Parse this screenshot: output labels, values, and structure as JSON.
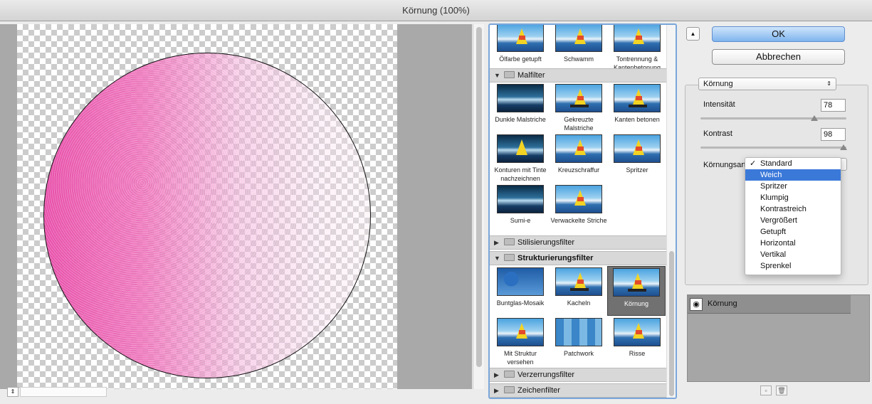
{
  "window": {
    "title": "Körnung (100%)"
  },
  "preview": {
    "zoom_glyph": "⇕"
  },
  "gallery": {
    "top_tiles": [
      {
        "label": "Ölfarbe getupft"
      },
      {
        "label": "Schwamm"
      },
      {
        "label": "Tontrennung & Kantenbetonung"
      }
    ],
    "groups": [
      {
        "name": "Malfilter",
        "expanded": true
      },
      {
        "name": "Stilisierungsfilter",
        "expanded": false
      },
      {
        "name": "Strukturierungsfilter",
        "expanded": true
      },
      {
        "name": "Verzerrungsfilter",
        "expanded": false
      },
      {
        "name": "Zeichenfilter",
        "expanded": false
      }
    ],
    "malfilter": [
      {
        "label": "Dunkle Malstriche"
      },
      {
        "label": "Gekreuzte Malstriche"
      },
      {
        "label": "Kanten betonen"
      },
      {
        "label": "Konturen mit Tinte nachzeichnen"
      },
      {
        "label": "Kreuzschraffur"
      },
      {
        "label": "Spritzer"
      },
      {
        "label": "Sumi-e"
      },
      {
        "label": "Verwackelte Striche"
      }
    ],
    "strukturierungsfilter": [
      {
        "label": "Buntglas-Mosaik"
      },
      {
        "label": "Kacheln"
      },
      {
        "label": "Körnung",
        "selected": true
      },
      {
        "label": "Mit Struktur versehen"
      },
      {
        "label": "Patchwork"
      },
      {
        "label": "Risse"
      }
    ],
    "expand_glyph": "▼",
    "collapse_glyph": "▶"
  },
  "buttons": {
    "ok": "OK",
    "cancel": "Abbrechen",
    "collapse_glyph": "▲"
  },
  "settings": {
    "filter_select": "Körnung",
    "select_arrows": "⇕",
    "intensity_label": "Intensität",
    "intensity_value": "78",
    "intensity_fraction": 0.78,
    "contrast_label": "Kontrast",
    "contrast_value": "98",
    "contrast_fraction": 0.98,
    "grain_type_label": "Körnungsart",
    "grain_type_options": [
      {
        "label": "Standard",
        "checked": true
      },
      {
        "label": "Weich",
        "highlighted": true
      },
      {
        "label": "Spritzer"
      },
      {
        "label": "Klumpig"
      },
      {
        "label": "Kontrastreich"
      },
      {
        "label": "Vergrößert"
      },
      {
        "label": "Getupft"
      },
      {
        "label": "Horizontal"
      },
      {
        "label": "Vertikal"
      },
      {
        "label": "Sprenkel"
      }
    ],
    "check_glyph": "✓"
  },
  "layers": {
    "items": [
      {
        "name": "Körnung",
        "visible": true
      }
    ],
    "eye_glyph": "◉",
    "new_layer_glyph": "▫",
    "delete_layer_glyph": "🗑"
  }
}
